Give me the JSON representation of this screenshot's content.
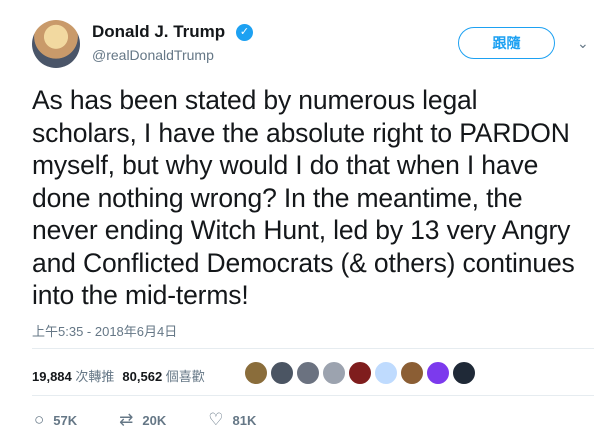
{
  "user": {
    "name": "Donald J. Trump",
    "handle": "@realDonaldTrump",
    "verified_symbol": "✓"
  },
  "follow_label": "跟隨",
  "more_symbol": "⌄",
  "tweet_text": "As has been stated by numerous legal scholars, I have the absolute right to PARDON myself, but why would I do that when I have done nothing wrong? In the meantime, the never ending Witch Hunt, led by 13 very Angry and Conflicted Democrats (& others) continues into the mid-terms!",
  "timestamp": "上午5:35 - 2018年6月4日",
  "stats": {
    "retweets_count": "19,884",
    "retweets_label": "次轉推",
    "likes_count": "80,562",
    "likes_label": "個喜歡"
  },
  "likers": [
    {
      "color": "#8a6d3b",
      "icon": "avatar"
    },
    {
      "color": "#4b5563",
      "icon": "avatar"
    },
    {
      "color": "#6b7280",
      "icon": "avatar"
    },
    {
      "color": "#9ca3af",
      "icon": "avatar"
    },
    {
      "color": "#7f1d1d",
      "icon": "avatar"
    },
    {
      "color": "#bfdbfe",
      "icon": "avatar"
    },
    {
      "color": "#8b5e34",
      "icon": "avatar"
    },
    {
      "color": "#7c3aed",
      "icon": "avatar"
    },
    {
      "color": "#1f2937",
      "icon": "avatar"
    }
  ],
  "actions": [
    {
      "name": "reply",
      "icon": "comment-icon",
      "symbol": "○",
      "count": "57K"
    },
    {
      "name": "retweet",
      "icon": "retweet-icon",
      "symbol": "⇄",
      "count": "20K"
    },
    {
      "name": "like",
      "icon": "heart-icon",
      "symbol": "♡",
      "count": "81K"
    }
  ],
  "colors": {
    "accent": "#1da1f2",
    "muted": "#657786",
    "text": "#14171a",
    "divider": "#e6ecf0"
  }
}
